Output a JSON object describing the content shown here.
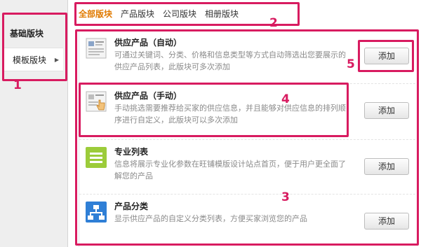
{
  "sidebar": {
    "items": [
      {
        "label": "基础版块"
      },
      {
        "label": "模板版块"
      }
    ]
  },
  "tabs": [
    {
      "label": "全部版块",
      "active": true
    },
    {
      "label": "产品版块"
    },
    {
      "label": "公司版块"
    },
    {
      "label": "相册版块"
    }
  ],
  "modules": [
    {
      "title": "供应产品（自动）",
      "desc": "可通过关键词、分类、价格和信息类型等方式自动筛选出您要展示的供应产品列表，此版块可多次添加",
      "icon": "auto-product-icon",
      "button": "添加"
    },
    {
      "title": "供应产品（手动）",
      "desc": "手动挑选需要推荐给买家的供应信息，并且能够对供应信息的排列顺序进行自定义，此版块可以多次添加",
      "icon": "manual-product-icon",
      "button": "添加"
    },
    {
      "title": "专业列表",
      "desc": "信息将展示专业化参数在旺铺模版设计站点首页，便于用户更全面了解您的产品",
      "icon": "list-icon",
      "button": "添加"
    },
    {
      "title": "产品分类",
      "desc": "显示供应产品的自定义分类列表，方便买家浏览您的产品",
      "icon": "category-icon",
      "button": "添加"
    }
  ],
  "annotations": [
    "1",
    "2",
    "3",
    "4",
    "5"
  ],
  "colors": {
    "annotation": "#d81b60",
    "active_tab": "#e07a00"
  }
}
